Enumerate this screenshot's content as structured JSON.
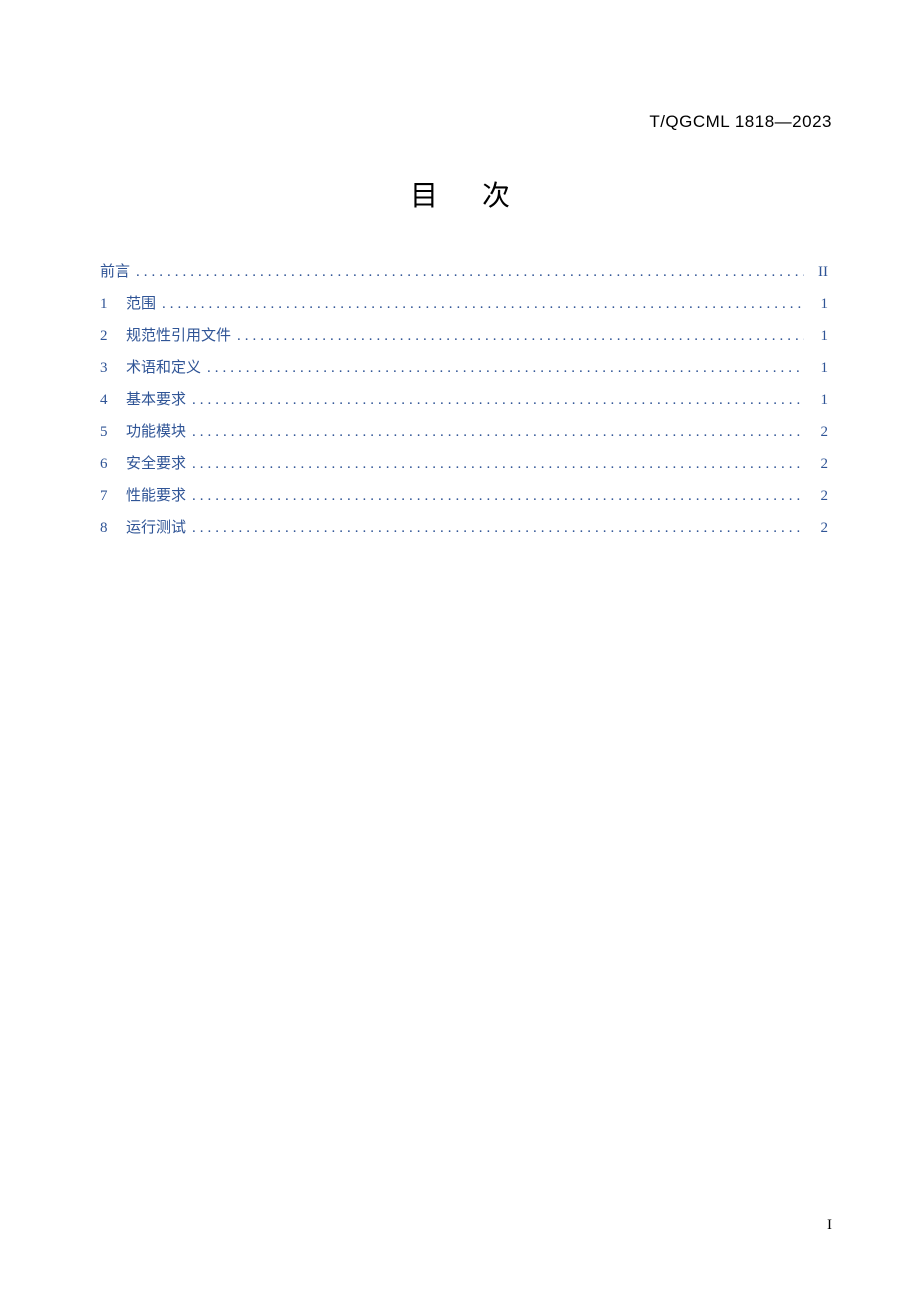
{
  "header": {
    "code": "T/QGCML 1818—2023"
  },
  "title": {
    "char1": "目",
    "char2": "次"
  },
  "toc": {
    "items": [
      {
        "num": "",
        "label": "前言",
        "page": "II"
      },
      {
        "num": "1",
        "label": "范围",
        "page": "1"
      },
      {
        "num": "2",
        "label": "规范性引用文件",
        "page": "1"
      },
      {
        "num": "3",
        "label": "术语和定义",
        "page": "1"
      },
      {
        "num": "4",
        "label": "基本要求",
        "page": "1"
      },
      {
        "num": "5",
        "label": "功能模块",
        "page": "2"
      },
      {
        "num": "6",
        "label": "安全要求",
        "page": "2"
      },
      {
        "num": "7",
        "label": "性能要求",
        "page": "2"
      },
      {
        "num": "8",
        "label": "运行测试",
        "page": "2"
      }
    ]
  },
  "footer": {
    "page_number": "I"
  }
}
